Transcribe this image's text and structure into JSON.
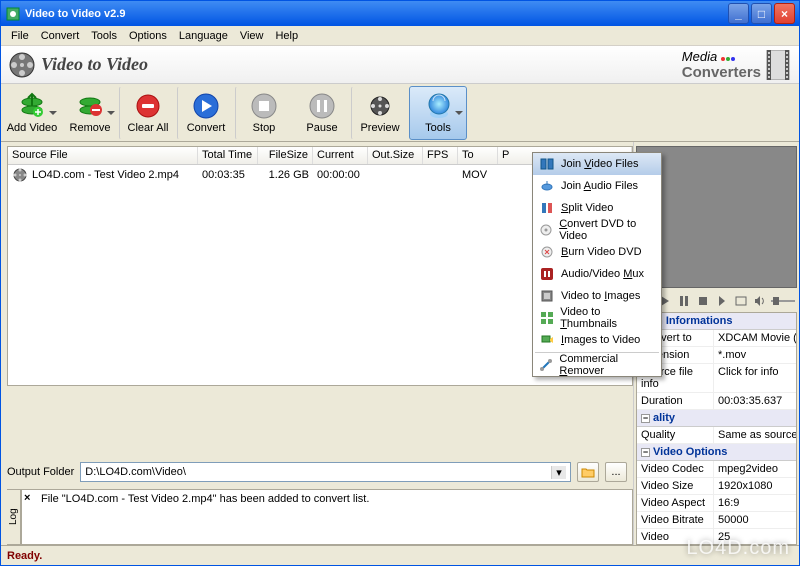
{
  "window": {
    "title": "Video to Video v2.9"
  },
  "menu": [
    "File",
    "Convert",
    "Tools",
    "Options",
    "Language",
    "View",
    "Help"
  ],
  "header": {
    "title": "Video to Video",
    "brand_media": "Media",
    "brand_conv": "Converters"
  },
  "toolbar": [
    {
      "label": "Add Video"
    },
    {
      "label": "Remove"
    },
    {
      "label": "Clear All"
    },
    {
      "label": "Convert"
    },
    {
      "label": "Stop"
    },
    {
      "label": "Pause"
    },
    {
      "label": "Preview"
    },
    {
      "label": "Tools"
    }
  ],
  "table": {
    "headers": [
      "Source File",
      "Total Time",
      "FileSize",
      "Current",
      "Out.Size",
      "FPS",
      "To",
      "P"
    ],
    "row": {
      "source": "LO4D.com - Test Video 2.mp4",
      "total": "00:03:35",
      "size": "1.26 GB",
      "current": "00:00:00",
      "outsize": "",
      "fps": "",
      "to": "MOV"
    }
  },
  "output": {
    "label": "Output Folder",
    "path": "D:\\LO4D.com\\Video\\"
  },
  "log": {
    "tab": "Log",
    "message": "File \"LO4D.com - Test Video 2.mp4\" has been added to convert list."
  },
  "status": "Ready.",
  "tools_menu": [
    "Join Video Files",
    "Join Audio Files",
    "Split Video",
    "Convert DVD to Video",
    "Burn Video DVD",
    "Audio/Video Mux",
    "Video to Images",
    "Video to Thumbnails",
    "Images to Video",
    "Commercial Remover"
  ],
  "props": {
    "sections": [
      {
        "title": "in Informations",
        "rows": [
          [
            "Convert to",
            "XDCAM Movie (*.m"
          ],
          [
            "Extension",
            "*.mov"
          ],
          [
            "Source file info",
            "Click for info"
          ],
          [
            "Duration",
            "00:03:35.637"
          ]
        ]
      },
      {
        "title": "ality",
        "rows": [
          [
            "Quality",
            "Same as source"
          ]
        ]
      },
      {
        "title": "Video Options",
        "rows": [
          [
            "Video Codec",
            "mpeg2video"
          ],
          [
            "Video Size",
            "1920x1080"
          ],
          [
            "Video Aspect",
            "16:9"
          ],
          [
            "Video Bitrate",
            "50000"
          ],
          [
            "Video Framerate",
            "25"
          ]
        ]
      }
    ]
  },
  "watermark": "LO4D.com"
}
